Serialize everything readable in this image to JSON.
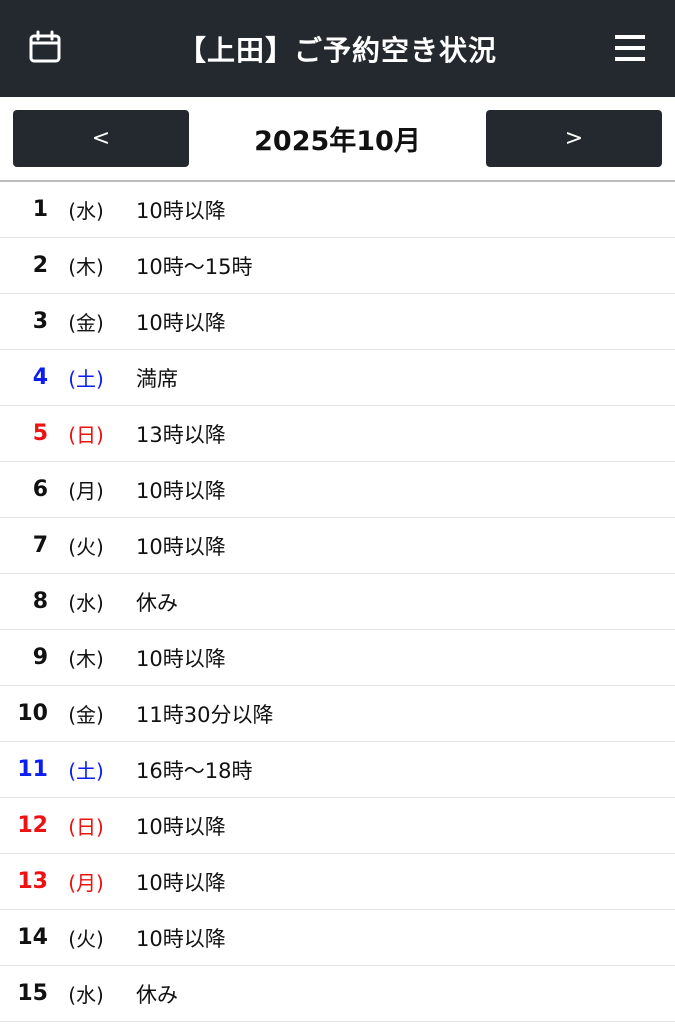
{
  "header": {
    "title": "【上田】ご予約空き状況"
  },
  "month_nav": {
    "prev_label": "<",
    "next_label": ">",
    "month_label": "2025年10月"
  },
  "days": [
    {
      "day": "1",
      "dow": "(水)",
      "status": "10時以降",
      "kind": "weekday"
    },
    {
      "day": "2",
      "dow": "(木)",
      "status": "10時〜15時",
      "kind": "weekday"
    },
    {
      "day": "3",
      "dow": "(金)",
      "status": "10時以降",
      "kind": "weekday"
    },
    {
      "day": "4",
      "dow": "(土)",
      "status": "満席",
      "kind": "sat"
    },
    {
      "day": "5",
      "dow": "(日)",
      "status": "13時以降",
      "kind": "sun"
    },
    {
      "day": "6",
      "dow": "(月)",
      "status": "10時以降",
      "kind": "weekday"
    },
    {
      "day": "7",
      "dow": "(火)",
      "status": "10時以降",
      "kind": "weekday"
    },
    {
      "day": "8",
      "dow": "(水)",
      "status": "休み",
      "kind": "weekday"
    },
    {
      "day": "9",
      "dow": "(木)",
      "status": "10時以降",
      "kind": "weekday"
    },
    {
      "day": "10",
      "dow": "(金)",
      "status": "11時30分以降",
      "kind": "weekday"
    },
    {
      "day": "11",
      "dow": "(土)",
      "status": "16時〜18時",
      "kind": "sat"
    },
    {
      "day": "12",
      "dow": "(日)",
      "status": "10時以降",
      "kind": "sun"
    },
    {
      "day": "13",
      "dow": "(月)",
      "status": "10時以降",
      "kind": "sun"
    },
    {
      "day": "14",
      "dow": "(火)",
      "status": "10時以降",
      "kind": "weekday"
    },
    {
      "day": "15",
      "dow": "(水)",
      "status": "休み",
      "kind": "weekday"
    }
  ],
  "colors": {
    "header_bg": "#23292e",
    "saturday": "#0b1df0",
    "sunday_holiday": "#ee1111"
  },
  "icons": {
    "left": "calendar-icon",
    "right": "hamburger-menu-icon"
  }
}
